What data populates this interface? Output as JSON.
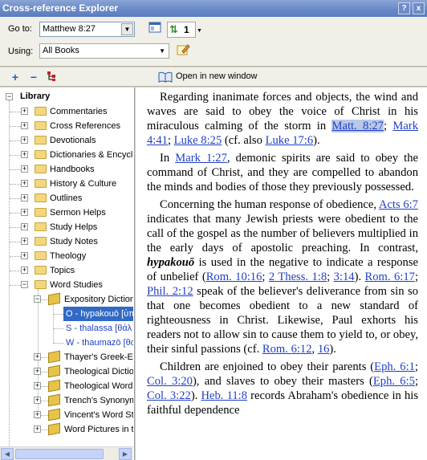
{
  "window": {
    "title": "Cross-reference Explorer",
    "help_btn": "?",
    "close_btn": "x"
  },
  "toolbar": {
    "goto_label": "Go to:",
    "goto_value": "Matthew 8:27",
    "using_label": "Using:",
    "using_value": "All Books",
    "count_value": "1",
    "open_new_window": "Open in new window"
  },
  "tree": {
    "root": "Library",
    "items": [
      "Commentaries",
      "Cross References",
      "Devotionals",
      "Dictionaries & Encyclo",
      "Handbooks",
      "History & Culture",
      "Outlines",
      "Sermon Helps",
      "Study Helps",
      "Study Notes",
      "Theology",
      "Topics",
      "Word Studies"
    ],
    "word_studies": {
      "expository": "Expository Diction",
      "sub": [
        "O - hypakouō [ὑπ",
        "S - thalassa [θάλ",
        "W - thaumazō [θα"
      ],
      "books": [
        "Thayer's Greek-En",
        "Theological Dictio",
        "Theological Wordb",
        "Trench's Synonym",
        "Vincent's Word St",
        "Word Pictures in t"
      ]
    }
  },
  "doc": {
    "p1": {
      "t1": "Regarding inanimate forces and objects, the wind and waves are said to obey the voice of Christ in his miraculous calming of the storm in ",
      "l1": "Matt. 8:27",
      "s1": "; ",
      "l2": "Mark 4:41",
      "s2": "; ",
      "l3": "Luke 8:25",
      "t2": " (cf. also ",
      "l4": "Luke 17:6",
      "t3": ")."
    },
    "p2": {
      "t1": "In ",
      "l1": "Mark 1:27",
      "t2": ", demonic spirits are said to obey the command of Christ, and they are compelled to abandon the minds and bodies of those they previously possessed."
    },
    "p3": {
      "t1": "Concerning the human response of obedience, ",
      "l1": "Acts 6:7",
      "t2": " indicates that many Jewish priests were obedient to the call of the gospel as the number of believers multiplied in the early days of apostolic preaching. In contrast, ",
      "word": "hypakouō",
      "t3": " is used in the negative to indicate a response of unbelief (",
      "l2": "Rom. 10:16",
      "s1": "; ",
      "l3": "2 Thess. 1:8",
      "s2": "; ",
      "l4": "3:14",
      "t4": "). ",
      "l5": "Rom. 6:17",
      "s3": "; ",
      "l6": "Phil. 2:12",
      "t5": " speak of the believer's deliverance from sin so that one becomes obedient to a new standard of righteousness in Christ. Likewise, Paul exhorts his readers not to allow sin to cause them to yield to, or obey, their sinful passions (cf. ",
      "l7": "Rom. 6:12",
      "s4": ", ",
      "l8": "16",
      "t6": ")."
    },
    "p4": {
      "t1": "Children are enjoined to obey their parents (",
      "l1": "Eph. 6:1",
      "s1": "; ",
      "l2": "Col. 3:20",
      "t2": "), and slaves to obey their masters (",
      "l3": "Eph. 6:5",
      "s2": "; ",
      "l4": "Col. 3:22",
      "t3": "). ",
      "l5": "Heb. 11:8",
      "t4": " records Abraham's obedience in his faithful dependence"
    }
  },
  "colors": {
    "titlebar": "#6c8cc8",
    "link": "#1f3fc5",
    "selection": "#316ac5"
  }
}
